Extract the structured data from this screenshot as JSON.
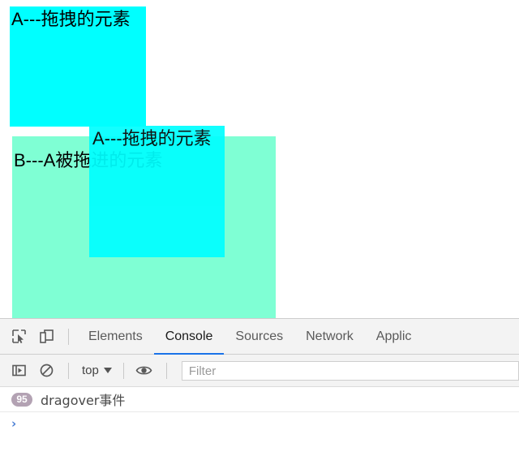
{
  "page": {
    "drag_source": {
      "label": "A---拖拽的元素",
      "color": "#00ffff"
    },
    "drop_target": {
      "label": "B---A被拖进的元素",
      "color": "#7fffd4"
    },
    "drag_ghost": {
      "label": "A---拖拽的元素",
      "color": "#00ffff"
    }
  },
  "devtools": {
    "icons": {
      "inspect": "inspect-element-icon",
      "device": "device-toolbar-icon",
      "sidebar": "console-sidebar-icon",
      "clear": "clear-console-icon",
      "eye": "live-expression-icon"
    },
    "tabs": [
      {
        "label": "Elements",
        "active": false
      },
      {
        "label": "Console",
        "active": true
      },
      {
        "label": "Sources",
        "active": false
      },
      {
        "label": "Network",
        "active": false
      },
      {
        "label": "Applic",
        "active": false
      }
    ],
    "toolbar": {
      "context": "top",
      "filter_placeholder": "Filter",
      "filter_value": ""
    },
    "console": {
      "messages": [
        {
          "count": "95",
          "text": "dragover事件"
        }
      ],
      "prompt": "›"
    },
    "accent_color": "#1a73e8",
    "badge_color": "#b3a2b3"
  }
}
